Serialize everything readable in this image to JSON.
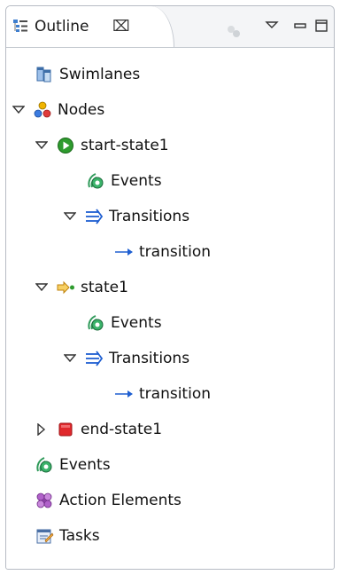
{
  "view": {
    "title": "Outline",
    "close_glyph": "⌧",
    "icons": {
      "tab": "outline-view-icon",
      "toolbar": "link-with-editor-icon",
      "menu": "view-menu-icon",
      "minimize": "minimize-icon",
      "maximize": "maximize-icon"
    }
  },
  "tree": {
    "swimlanes": {
      "label": "Swimlanes",
      "icon": "swimlanes-icon"
    },
    "nodes": {
      "label": "Nodes",
      "icon": "nodes-icon",
      "expanded": true
    },
    "start_state": {
      "label": "start-state1",
      "icon": "start-state-icon",
      "expanded": true
    },
    "start_events": {
      "label": "Events",
      "icon": "events-icon"
    },
    "start_transitions": {
      "label": "Transitions",
      "icon": "transitions-icon",
      "expanded": true
    },
    "start_transition": {
      "label": "transition",
      "icon": "transition-arrow-icon"
    },
    "state": {
      "label": "state1",
      "icon": "state-icon",
      "expanded": true
    },
    "state_events": {
      "label": "Events",
      "icon": "events-icon"
    },
    "state_transitions": {
      "label": "Transitions",
      "icon": "transitions-icon",
      "expanded": true
    },
    "state_transition": {
      "label": "transition",
      "icon": "transition-arrow-icon"
    },
    "end_state": {
      "label": "end-state1",
      "icon": "end-state-icon",
      "expanded": false
    },
    "events": {
      "label": "Events",
      "icon": "events-icon"
    },
    "action_elements": {
      "label": "Action Elements",
      "icon": "action-elements-icon"
    },
    "tasks": {
      "label": "Tasks",
      "icon": "tasks-icon"
    }
  },
  "colors": {
    "start_state": "#2e9b2e",
    "end_state": "#e0282c",
    "transition_arrow": "#1f5fd1",
    "state": "#e8a317"
  }
}
